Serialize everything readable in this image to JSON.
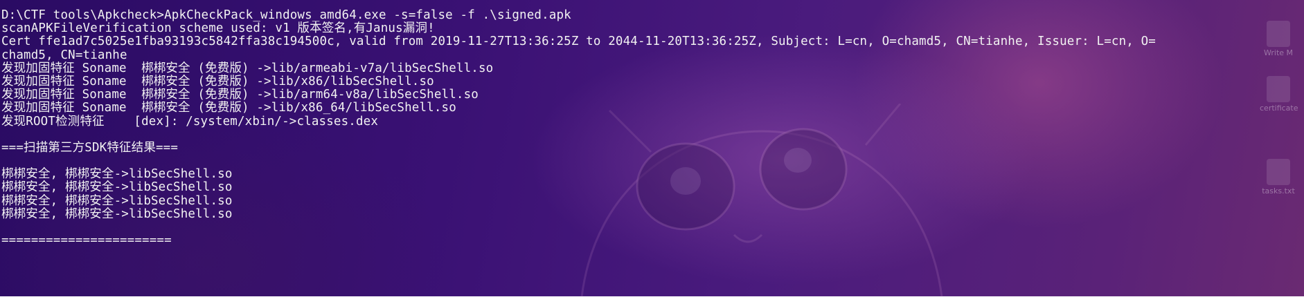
{
  "terminal": {
    "lines": [
      "D:\\CTF tools\\Apkcheck>ApkCheckPack_windows_amd64.exe -s=false -f .\\signed.apk",
      "scanAPKFileVerification scheme used: v1 版本签名,有Janus漏洞!",
      "Cert ffe1ad7c5025e1fba93193c5842ffa38c194500c, valid from 2019-11-27T13:36:25Z to 2044-11-20T13:36:25Z, Subject: L=cn, O=chamd5, CN=tianhe, Issuer: L=cn, O=",
      "chamd5, CN=tianhe",
      "发现加固特征 Soname  梆梆安全 (免费版) ->lib/armeabi-v7a/libSecShell.so",
      "发现加固特征 Soname  梆梆安全 (免费版) ->lib/x86/libSecShell.so",
      "发现加固特征 Soname  梆梆安全 (免费版) ->lib/arm64-v8a/libSecShell.so",
      "发现加固特征 Soname  梆梆安全 (免费版) ->lib/x86_64/libSecShell.so",
      "发现ROOT检测特征    [dex]: /system/xbin/->classes.dex",
      "",
      "===扫描第三方SDK特征结果===",
      "",
      "梆梆安全, 梆梆安全->libSecShell.so",
      "梆梆安全, 梆梆安全->libSecShell.so",
      "梆梆安全, 梆梆安全->libSecShell.so",
      "梆梆安全, 梆梆安全->libSecShell.so",
      "",
      "======================="
    ]
  },
  "desktop": {
    "icons": [
      {
        "label": "Write M",
        "icon": "document-icon"
      },
      {
        "label": "certificate",
        "icon": "folder-icon"
      },
      {
        "label": "tasks.txt",
        "icon": "text-file-icon"
      }
    ]
  },
  "colors": {
    "text": "#f2f2f2",
    "background": "#3a1174"
  }
}
